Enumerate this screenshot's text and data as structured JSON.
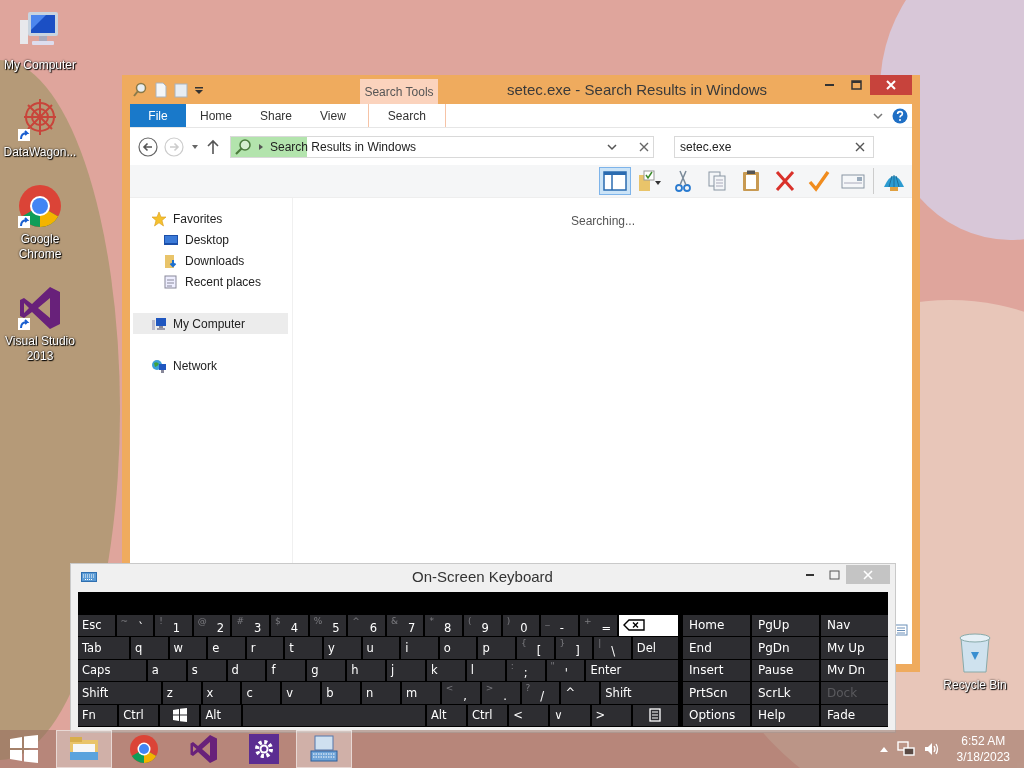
{
  "desktop_icons": [
    {
      "label": "My Computer",
      "kind": "computer",
      "shortcut": false
    },
    {
      "label": "DataWagon...",
      "kind": "datawagon",
      "shortcut": true
    },
    {
      "label": "Google Chrome",
      "kind": "chrome",
      "shortcut": true
    },
    {
      "label": "Visual Studio 2013",
      "kind": "vs",
      "shortcut": true
    },
    {
      "label": "Recycle Bin",
      "kind": "recycle",
      "shortcut": false
    }
  ],
  "explorer": {
    "title": "setec.exe - Search Results in Windows",
    "context_tab_group": "Search Tools",
    "ribbon_tabs": [
      {
        "label": "File",
        "kind": "file",
        "selected": false
      },
      {
        "label": "Home",
        "kind": "tab",
        "selected": false
      },
      {
        "label": "Share",
        "kind": "tab",
        "selected": false
      },
      {
        "label": "View",
        "kind": "tab",
        "selected": false
      },
      {
        "label": "Search",
        "kind": "context",
        "selected": false
      }
    ],
    "address_bar": {
      "path": "Search Results in Windows",
      "level": 0.18
    },
    "search_box": {
      "value": "setec.exe"
    },
    "toolbar": [
      {
        "kind": "preview-pane",
        "selected": true
      },
      {
        "kind": "folder-check",
        "selected": false
      },
      {
        "kind": "cut",
        "selected": false
      },
      {
        "kind": "copy",
        "selected": false
      },
      {
        "kind": "paste",
        "selected": false
      },
      {
        "kind": "delete",
        "selected": false
      },
      {
        "kind": "check",
        "selected": false
      },
      {
        "kind": "card",
        "selected": false
      },
      {
        "kind": "shell",
        "selected": false
      }
    ],
    "nav": [
      {
        "label": "Favorites",
        "kind": "star",
        "selected": false,
        "children": [
          {
            "label": "Desktop",
            "kind": "desktop",
            "selected": false
          },
          {
            "label": "Downloads",
            "kind": "downloads",
            "selected": false
          },
          {
            "label": "Recent places",
            "kind": "recent",
            "selected": false
          }
        ]
      },
      {
        "label": "My Computer",
        "kind": "computer",
        "selected": true
      },
      {
        "label": "Network",
        "kind": "network",
        "selected": false
      }
    ],
    "status": "Searching..."
  },
  "keyboard": {
    "title": "On-Screen Keyboard",
    "rows": [
      {
        "keys": [
          {
            "label": "Esc"
          },
          {
            "shift": "~",
            "label": "`"
          },
          {
            "shift": "!",
            "label": "1"
          },
          {
            "shift": "@",
            "label": "2"
          },
          {
            "shift": "#",
            "label": "3"
          },
          {
            "shift": "$",
            "label": "4"
          },
          {
            "shift": "%",
            "label": "5"
          },
          {
            "shift": "^",
            "label": "6"
          },
          {
            "shift": "&",
            "label": "7"
          },
          {
            "shift": "*",
            "label": "8"
          },
          {
            "shift": "(",
            "label": "9"
          },
          {
            "shift": ")",
            "label": "0"
          },
          {
            "shift": "_",
            "label": "-"
          },
          {
            "shift": "+",
            "label": "="
          },
          {
            "kind": "backspace"
          }
        ]
      },
      {
        "keys": [
          {
            "label": "Tab"
          },
          {
            "label": "q"
          },
          {
            "label": "w"
          },
          {
            "label": "e"
          },
          {
            "label": "r"
          },
          {
            "label": "t"
          },
          {
            "label": "y"
          },
          {
            "label": "u"
          },
          {
            "label": "i"
          },
          {
            "label": "o"
          },
          {
            "label": "p"
          },
          {
            "shift": "{",
            "label": "["
          },
          {
            "shift": "}",
            "label": "]"
          },
          {
            "shift": "|",
            "label": "\\"
          },
          {
            "label": "Del"
          }
        ]
      },
      {
        "keys": [
          {
            "label": "Caps"
          },
          {
            "label": "a"
          },
          {
            "label": "s"
          },
          {
            "label": "d"
          },
          {
            "label": "f"
          },
          {
            "label": "g"
          },
          {
            "label": "h"
          },
          {
            "label": "j"
          },
          {
            "label": "k"
          },
          {
            "label": "l"
          },
          {
            "shift": ":",
            "label": ";"
          },
          {
            "shift": "\"",
            "label": "'"
          },
          {
            "label": "Enter"
          }
        ]
      },
      {
        "keys": [
          {
            "label": "Shift"
          },
          {
            "label": "z"
          },
          {
            "label": "x"
          },
          {
            "label": "c"
          },
          {
            "label": "v"
          },
          {
            "label": "b"
          },
          {
            "label": "n"
          },
          {
            "label": "m"
          },
          {
            "shift": "<",
            "label": ","
          },
          {
            "shift": ">",
            "label": "."
          },
          {
            "shift": "?",
            "label": "/"
          },
          {
            "label": "^"
          },
          {
            "label": "Shift"
          }
        ]
      },
      {
        "keys": [
          {
            "label": "Fn"
          },
          {
            "label": "Ctrl"
          },
          {
            "kind": "windows"
          },
          {
            "label": "Alt"
          },
          {
            "kind": "space"
          },
          {
            "label": "Alt"
          },
          {
            "label": "Ctrl"
          },
          {
            "label": "<"
          },
          {
            "label": "∨"
          },
          {
            "label": ">"
          },
          {
            "kind": "menu"
          }
        ]
      }
    ],
    "side_keys": [
      [
        {
          "label": "Home",
          "disabled": false
        },
        {
          "label": "PgUp",
          "disabled": false
        },
        {
          "label": "Nav",
          "disabled": false
        }
      ],
      [
        {
          "label": "End",
          "disabled": false
        },
        {
          "label": "PgDn",
          "disabled": false
        },
        {
          "label": "Mv Up",
          "disabled": false
        }
      ],
      [
        {
          "label": "Insert",
          "disabled": false
        },
        {
          "label": "Pause",
          "disabled": false
        },
        {
          "label": "Mv Dn",
          "disabled": false
        }
      ],
      [
        {
          "label": "PrtScn",
          "disabled": false
        },
        {
          "label": "ScrLk",
          "disabled": false
        },
        {
          "label": "Dock",
          "disabled": true
        }
      ],
      [
        {
          "label": "Options",
          "disabled": false
        },
        {
          "label": "Help",
          "disabled": false
        },
        {
          "label": "Fade",
          "disabled": false
        }
      ]
    ]
  },
  "taskbar": {
    "items": [
      {
        "kind": "explorer",
        "active": true
      },
      {
        "kind": "chrome",
        "active": false
      },
      {
        "kind": "vs",
        "active": false
      },
      {
        "kind": "settings",
        "active": false
      },
      {
        "kind": "keyboard",
        "active": true
      }
    ],
    "clock": {
      "time": "6:52 AM",
      "date": "3/18/2023"
    }
  }
}
